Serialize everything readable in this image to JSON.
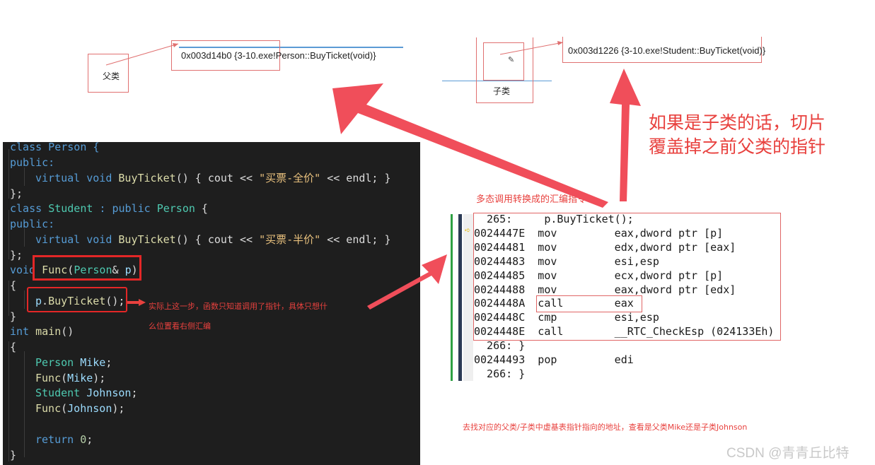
{
  "diagram_top_left": {
    "parent_label": "父类",
    "pointer_text": "0x003d14b0 {3-10.exe!Person::BuyTicket(void)}"
  },
  "diagram_top_right": {
    "child_label": "子类",
    "pointer_text": "0x003d1226 {3-10.exe!Student::BuyTicket(void)}"
  },
  "notes": {
    "slice_line1": "如果是子类的话，切片",
    "slice_line2": "覆盖掉之前父类的指针",
    "asm_caption": "多态调用转换成的汇编指令",
    "actual_line1": "实际上这一步，函数只知道调用了指针，具体只想什",
    "actual_line2": "么位置看右侧汇编",
    "bottom_note": "去找对应的父类/子类中虚基表指针指向的地址，查看是父类Mike还是子类Johnson",
    "watermark": "CSDN @青青丘比特"
  },
  "code": {
    "class_person": "class Person {",
    "public1": "public:",
    "virtual_kw1": "virtual",
    "void_kw1": "void",
    "buyticket1": "BuyTicket",
    "body1_a": "() { cout << ",
    "str1": "\"买票-全价\"",
    "body1_b": " << endl; }",
    "end1": "};",
    "class_student_kw": "class",
    "class_student_name": "Student",
    "class_student_rest": " : public ",
    "class_student_base": "Person",
    "class_student_brace": " {",
    "public2": "public:",
    "virtual_kw2": "virtual",
    "void_kw2": "void",
    "buyticket2": "BuyTicket",
    "body2_a": "() { cout << ",
    "str2": "\"买票-半价\"",
    "body2_b": " << endl; }",
    "end2": "};",
    "void_func_kw": "void",
    "func_name": "Func",
    "func_paren": "(",
    "func_type": "Person",
    "func_amp": "&",
    "func_param": "p",
    "func_close": ")",
    "brace_open1": "{",
    "call_obj": "p",
    "call_dot": ".",
    "call_fn": "BuyTicket",
    "call_rest": "();",
    "brace_close1": "}",
    "int_kw": "int",
    "main_fn": "main",
    "main_paren": "()",
    "brace_open2": "{",
    "person_type": "Person",
    "mike_var": "Mike",
    "func_call1_fn": "Func",
    "func_call1_arg": "Mike",
    "student_type": "Student",
    "johnson_var": "Johnson",
    "func_call2_fn": "Func",
    "func_call2_arg": "Johnson",
    "return_kw": "return",
    "return_val": "0",
    "brace_close2": "}"
  },
  "asm": [
    "  265:     p.BuyTicket();",
    "0024447E  mov         eax,dword ptr [p]",
    "00244481  mov         edx,dword ptr [eax]",
    "00244483  mov         esi,esp",
    "00244485  mov         ecx,dword ptr [p]",
    "00244488  mov         eax,dword ptr [edx]",
    "0024448A  call        eax",
    "0024448C  cmp         esi,esp",
    "0024448E  call        __RTC_CheckEsp (024133Eh)",
    "  266: }",
    "00244493  pop         edi",
    "  266: }"
  ],
  "colors": {
    "annotation_red": "#e8413e",
    "arrow_red": "#f04e5a",
    "code_bg": "#1e1e1e"
  }
}
